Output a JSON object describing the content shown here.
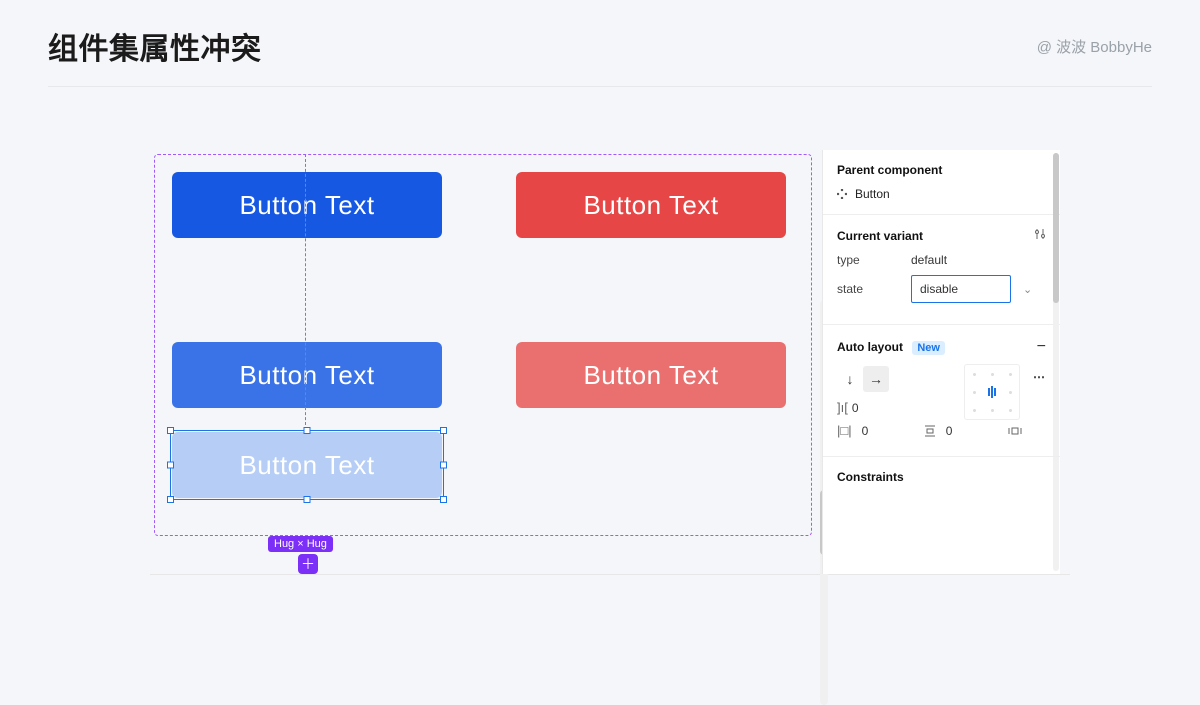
{
  "header": {
    "title": "组件集属性冲突",
    "author": "@ 波波 BobbyHe"
  },
  "canvas": {
    "button_label": "Button Text",
    "size_badge": "Hug × Hug"
  },
  "panel": {
    "parent_component": {
      "title": "Parent component",
      "name": "Button"
    },
    "variant": {
      "title": "Current variant",
      "props": {
        "type_label": "type",
        "type_value": "default",
        "state_label": "state",
        "state_value": "disable"
      }
    },
    "auto_layout": {
      "title": "Auto layout",
      "badge": "New",
      "gap": "0",
      "pad_h": "0",
      "pad_v": "0"
    },
    "constraints": {
      "title": "Constraints"
    }
  }
}
